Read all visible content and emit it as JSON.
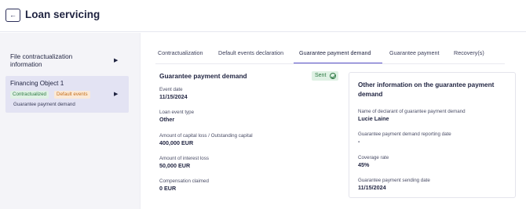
{
  "header": {
    "title": "Loan servicing",
    "back_icon": "←"
  },
  "sidebar": {
    "item1": {
      "label": "File contractualization information"
    },
    "card": {
      "title": "Financing Object 1",
      "tags": [
        "Contractualized",
        "Default events"
      ],
      "subtitle": "Guarantee payment demand"
    },
    "arrow_glyph": "▶"
  },
  "tabs": [
    {
      "label": "Contractualization"
    },
    {
      "label": "Default events declaration"
    },
    {
      "label": "Guarantee payment demand",
      "active": true
    },
    {
      "label": "Guarantee payment"
    },
    {
      "label": "Recovery(s)"
    }
  ],
  "main": {
    "title": "Guarantee payment demand",
    "status": "Sent",
    "fields": [
      {
        "label": "Event date",
        "value": "11/15/2024"
      },
      {
        "label": "Loan event type",
        "value": "Other"
      },
      {
        "label": "Amount of capital loss / Outstanding capital",
        "value": "400,000 EUR"
      },
      {
        "label": "Amount of interest loss",
        "value": "50,000 EUR"
      },
      {
        "label": "Compensation claimed",
        "value": "0 EUR"
      }
    ]
  },
  "other": {
    "title": "Other information on the guarantee payment demand",
    "fields": [
      {
        "label": "Name of declarant of guarantee payment demand",
        "value": "Lucie Laine"
      },
      {
        "label": "Guarantee payment demand reporting date",
        "value": "-"
      },
      {
        "label": "Coverage rate",
        "value": "45%"
      },
      {
        "label": "Guarantee payment sending date",
        "value": "11/15/2024"
      }
    ]
  },
  "colors": {
    "accent": "#5b55c9",
    "sent_bg": "#dff1e4",
    "sent_fg": "#2f7a45",
    "default_bg": "#fbe9d6",
    "default_fg": "#c46f1e"
  }
}
